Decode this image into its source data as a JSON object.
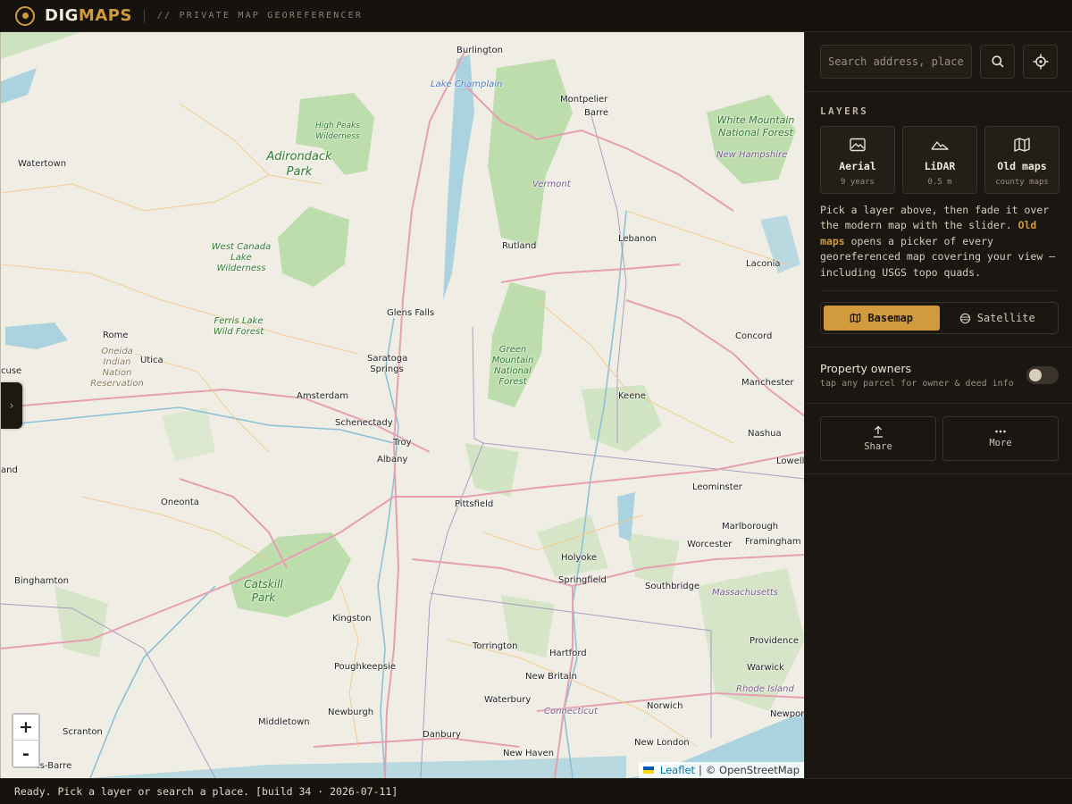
{
  "header": {
    "brand_a": "DIG",
    "brand_b": "MAPS",
    "tagline": "// PRIVATE MAP GEOREFERENCER"
  },
  "colors": {
    "accent": "#d19a3c",
    "panel_bg": "#1a1611",
    "map_land": "#f0ede5",
    "park_green": "#a9d39a",
    "water": "#aad3df"
  },
  "map": {
    "labels": [
      {
        "text": "Burlington",
        "kind": "city"
      },
      {
        "text": "Lake Champlain",
        "kind": "water"
      },
      {
        "text": "Montpelier",
        "kind": "city"
      },
      {
        "text": "Barre",
        "kind": "city"
      },
      {
        "text": "High Peaks Wilderness",
        "kind": "park"
      },
      {
        "text": "Adirondack Park",
        "kind": "park-big"
      },
      {
        "text": "Watertown",
        "kind": "city"
      },
      {
        "text": "Vermont",
        "kind": "region"
      },
      {
        "text": "White Mountain National Forest",
        "kind": "park"
      },
      {
        "text": "New Hampshire",
        "kind": "region"
      },
      {
        "text": "West Canada Lake Wilderness",
        "kind": "park"
      },
      {
        "text": "Rutland",
        "kind": "city"
      },
      {
        "text": "Lebanon",
        "kind": "city"
      },
      {
        "text": "Laconia",
        "kind": "city"
      },
      {
        "text": "Ferris Lake Wild Forest",
        "kind": "park"
      },
      {
        "text": "Glens Falls",
        "kind": "city"
      },
      {
        "text": "Rome",
        "kind": "city"
      },
      {
        "text": "Utica",
        "kind": "city"
      },
      {
        "text": "Oneida Indian Nation Reservation",
        "kind": "reservation"
      },
      {
        "text": "Saratoga Springs",
        "kind": "city"
      },
      {
        "text": "Green Mountain National Forest",
        "kind": "park"
      },
      {
        "text": "Concord",
        "kind": "city"
      },
      {
        "text": "cuse",
        "kind": "city"
      },
      {
        "text": "Amsterdam",
        "kind": "city"
      },
      {
        "text": "Keene",
        "kind": "city"
      },
      {
        "text": "Manchester",
        "kind": "city"
      },
      {
        "text": "Schenectady",
        "kind": "city"
      },
      {
        "text": "Troy",
        "kind": "city"
      },
      {
        "text": "Nashua",
        "kind": "city"
      },
      {
        "text": "Albany",
        "kind": "city"
      },
      {
        "text": "Lowell",
        "kind": "city"
      },
      {
        "text": "Leominster",
        "kind": "city"
      },
      {
        "text": "and",
        "kind": "city"
      },
      {
        "text": "Oneonta",
        "kind": "city"
      },
      {
        "text": "Pittsfield",
        "kind": "city"
      },
      {
        "text": "Marlborough",
        "kind": "city"
      },
      {
        "text": "Framingham",
        "kind": "city"
      },
      {
        "text": "Worcester",
        "kind": "city"
      },
      {
        "text": "Holyoke",
        "kind": "city"
      },
      {
        "text": "Springfield",
        "kind": "city"
      },
      {
        "text": "Binghamton",
        "kind": "city"
      },
      {
        "text": "Catskill Park",
        "kind": "park-big"
      },
      {
        "text": "Southbridge",
        "kind": "city"
      },
      {
        "text": "Massachusetts",
        "kind": "region"
      },
      {
        "text": "Kingston",
        "kind": "city"
      },
      {
        "text": "Torrington",
        "kind": "city"
      },
      {
        "text": "Providence",
        "kind": "city"
      },
      {
        "text": "Hartford",
        "kind": "city"
      },
      {
        "text": "Poughkeepsie",
        "kind": "city"
      },
      {
        "text": "Warwick",
        "kind": "city"
      },
      {
        "text": "New Britain",
        "kind": "city"
      },
      {
        "text": "Rhode Island",
        "kind": "region"
      },
      {
        "text": "Waterbury",
        "kind": "city"
      },
      {
        "text": "Newburgh",
        "kind": "city"
      },
      {
        "text": "Norwich",
        "kind": "city"
      },
      {
        "text": "Connecticut",
        "kind": "region"
      },
      {
        "text": "Newport",
        "kind": "city"
      },
      {
        "text": "Middletown",
        "kind": "city"
      },
      {
        "text": "Scranton",
        "kind": "city"
      },
      {
        "text": "Danbury",
        "kind": "city"
      },
      {
        "text": "New London",
        "kind": "city"
      },
      {
        "text": "New Haven",
        "kind": "city"
      },
      {
        "text": "Wilkes-Barre",
        "kind": "city"
      }
    ],
    "zoom_in": "+",
    "zoom_out": "-",
    "attribution": {
      "leaflet": "Leaflet",
      "separator": "|",
      "osm": "© OpenStreetMap"
    },
    "collapse_glyph": "›"
  },
  "panel": {
    "search": {
      "placeholder": "Search address, place, or parcel"
    },
    "search_icon": "search-icon",
    "locate_icon": "crosshair-icon",
    "layers_title": "LAYERS",
    "layers": [
      {
        "name": "Aerial",
        "sub": "9 years",
        "icon": "image-icon"
      },
      {
        "name": "LiDAR",
        "sub": "0.5 m",
        "icon": "mountain-icon"
      },
      {
        "name": "Old maps",
        "sub": "county maps",
        "icon": "map-icon"
      }
    ],
    "help": {
      "part1": "Pick a layer above, then fade it over the modern map with the slider. ",
      "highlight": "Old maps",
      "part2": " opens a picker of every georeferenced map covering your view — including USGS topo quads."
    },
    "basemap_toggle": {
      "basemap": "Basemap",
      "satellite": "Satellite",
      "selected": "Basemap"
    },
    "property_owners": {
      "title": "Property owners",
      "subtitle": "tap any parcel for owner & deed info",
      "enabled": false
    },
    "actions": [
      {
        "label": "Share",
        "icon": "share-icon"
      },
      {
        "label": "More",
        "icon": "more-icon"
      }
    ]
  },
  "status": {
    "text": "Ready. Pick a layer or search a place. [build 34 · 2026-07-11]"
  }
}
